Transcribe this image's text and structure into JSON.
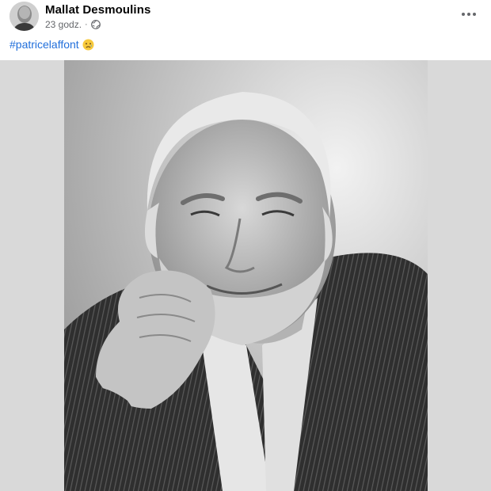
{
  "post": {
    "author": "Mallat Desmoulins",
    "timestamp": "23 godz.",
    "separator": "·",
    "audience_icon": "globe-icon",
    "more_icon": "more-horizontal-icon",
    "text": {
      "hashtag": "#patricelaffont",
      "emoji": "sad-tear-emoji"
    },
    "photo": {
      "subject": "portrait-photo"
    }
  },
  "colors": {
    "hashtag": "#216fdb",
    "name": "#050505",
    "meta": "#65676b",
    "frame_background": "#d9d9d9"
  }
}
